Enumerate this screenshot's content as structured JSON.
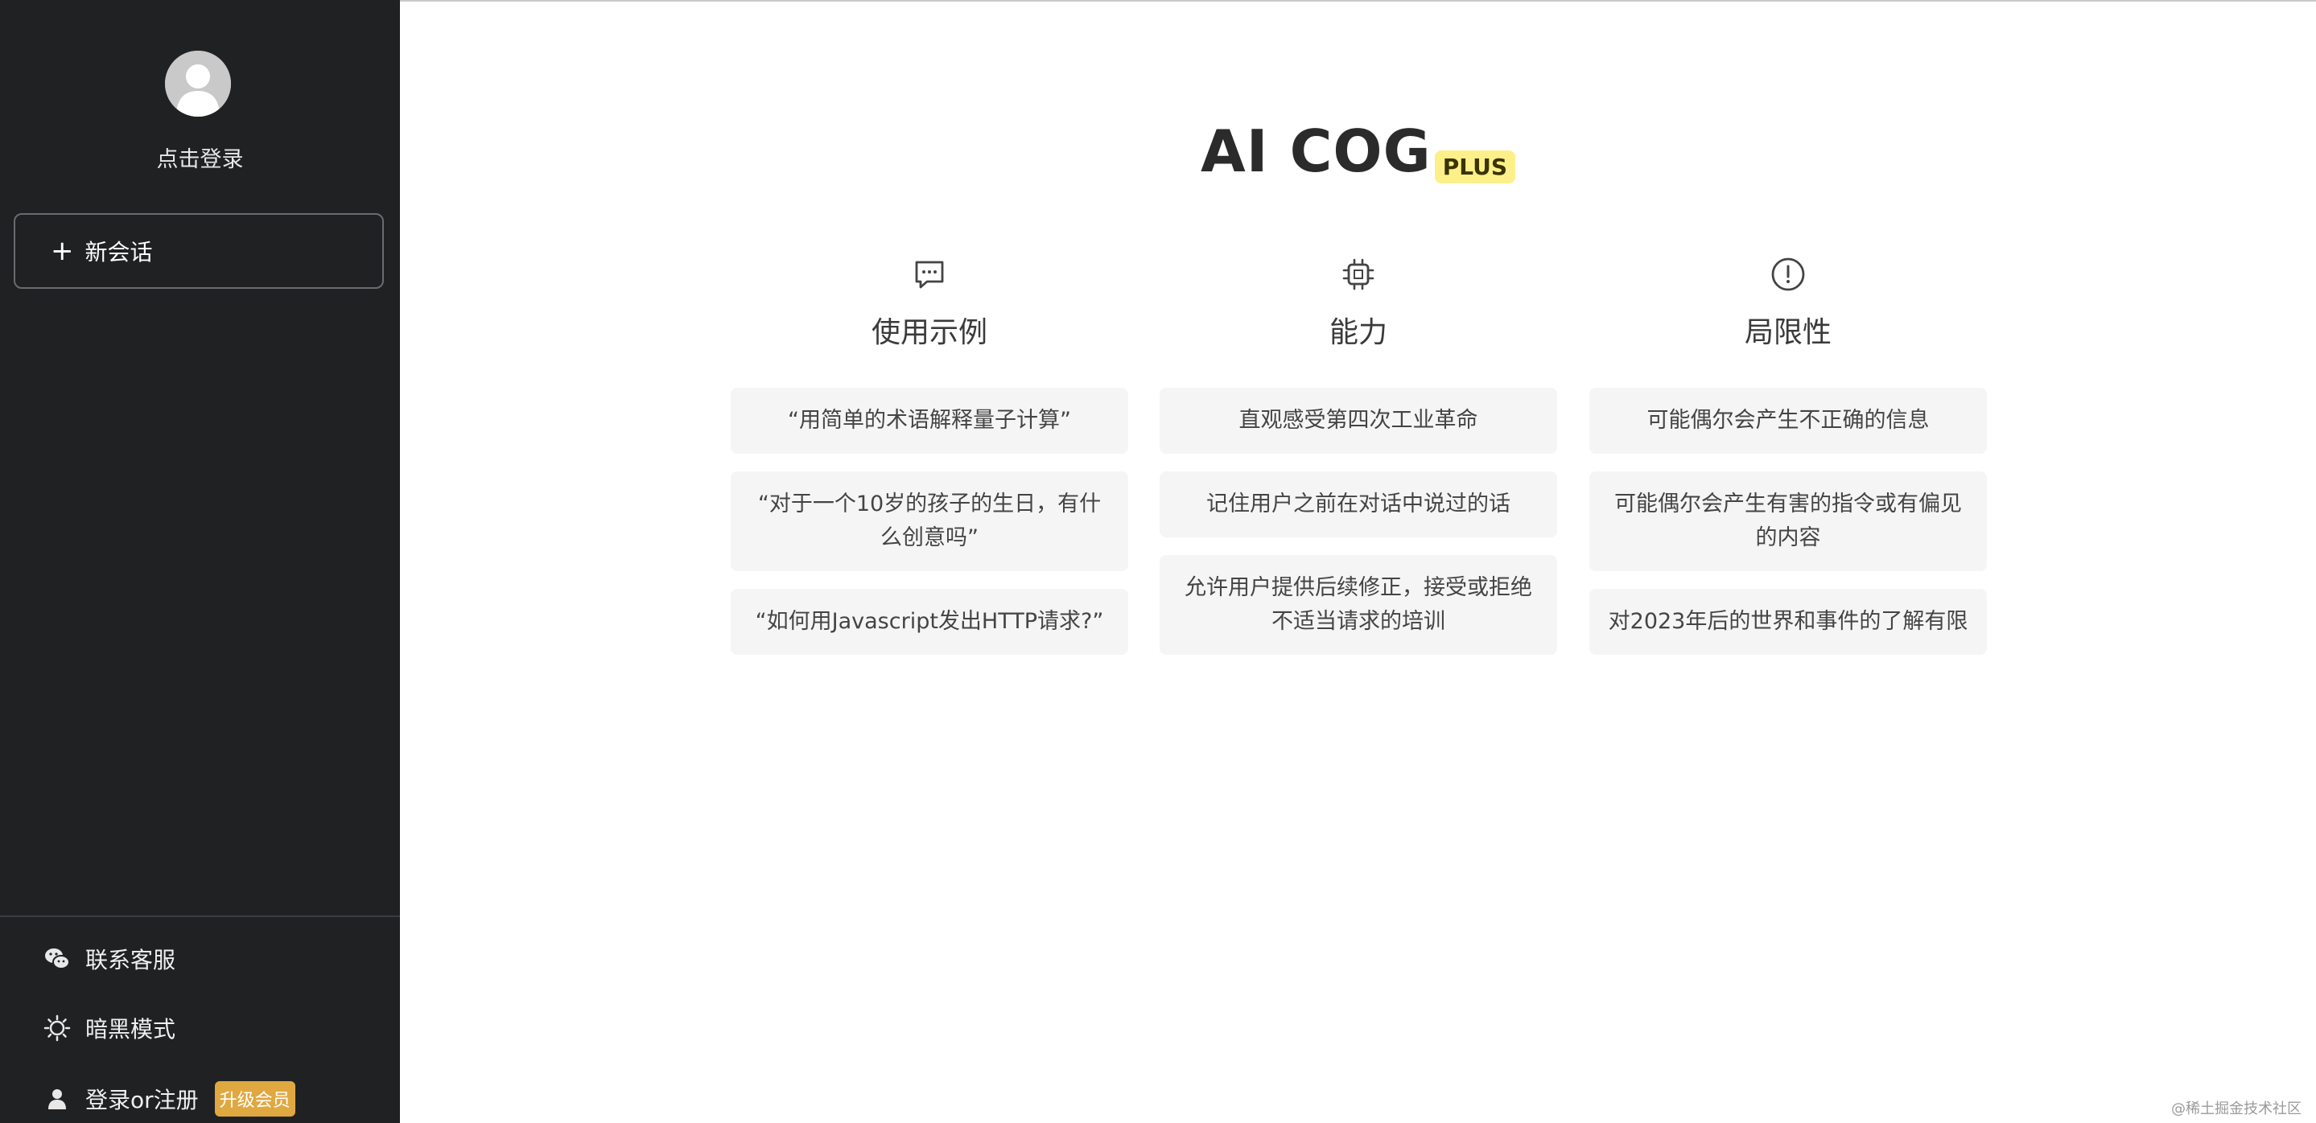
{
  "sidebar": {
    "login_prompt": "点击登录",
    "new_chat_label": "新会话",
    "bottom_items": [
      {
        "label": "联系客服",
        "icon": "wechat-icon"
      },
      {
        "label": "暗黑模式",
        "icon": "sun-icon"
      },
      {
        "label": "登录or注册",
        "icon": "user-icon"
      }
    ],
    "vip_badge": "升级会员"
  },
  "header": {
    "title": "AI COG",
    "badge": "PLUS"
  },
  "columns": [
    {
      "title": "使用示例",
      "icon": "chat-bubble-icon",
      "cards": [
        "“用简单的术语解释量子计算”",
        "“对于一个10岁的孩子的生日，有什么创意吗”",
        "“如何用Javascript发出HTTP请求?”"
      ]
    },
    {
      "title": "能力",
      "icon": "chip-icon",
      "cards": [
        "直观感受第四次工业革命",
        "记住用户之前在对话中说过的话",
        "允许用户提供后续修正，接受或拒绝不适当请求的培训"
      ]
    },
    {
      "title": "局限性",
      "icon": "warning-icon",
      "cards": [
        "可能偶尔会产生不正确的信息",
        "可能偶尔会产生有害的指令或有偏见的内容",
        "对2023年后的世界和事件的了解有限"
      ]
    }
  ],
  "watermark": "@稀土掘金技术社区",
  "colors": {
    "sidebar_bg": "#202123",
    "vip_badge_bg": "#e0a841",
    "plus_badge_bg": "#fdf089"
  }
}
